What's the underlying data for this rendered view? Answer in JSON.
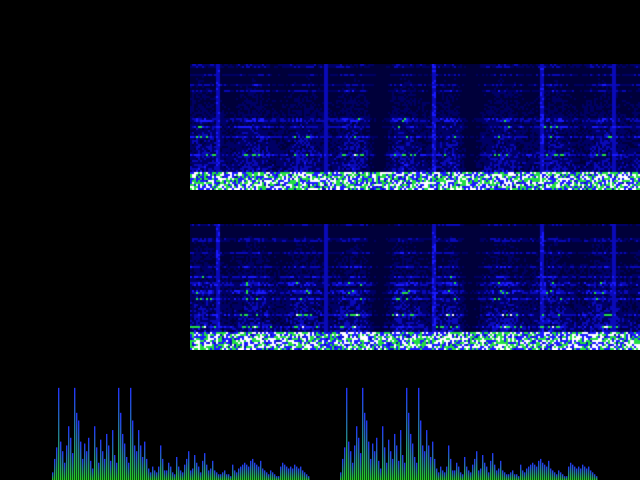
{
  "visualizer": {
    "background": "#000000",
    "palette": {
      "low": "#000066",
      "mid": "#1a1aff",
      "high": "#22dd44",
      "peak": "#ffffff"
    },
    "spectrogram": {
      "channels": [
        "left",
        "right"
      ],
      "columns": 225,
      "rows": 63,
      "transients": [
        {
          "t": 0.06,
          "level": 0.95
        },
        {
          "t": 0.3,
          "level": 0.9
        },
        {
          "t": 0.54,
          "level": 1.0
        },
        {
          "t": 0.78,
          "level": 0.95
        },
        {
          "t": 0.94,
          "level": 0.85
        }
      ],
      "pulse_count": 9
    },
    "spectrum": {
      "gradient_bottom": "#22cc22",
      "gradient_top": "#2233ff",
      "groups": [
        {
          "values": [
            0.08,
            0.22,
            0.34,
            0.96,
            0.4,
            0.3,
            0.18,
            0.36,
            0.56,
            0.44,
            0.28,
            0.96,
            0.7,
            0.62,
            0.4,
            0.22,
            0.38,
            0.3,
            0.44,
            0.2,
            0.12,
            0.56,
            0.34,
            0.18,
            0.42,
            0.3,
            0.22,
            0.48,
            0.36,
            0.2,
            0.52,
            0.26,
            0.18,
            0.96,
            0.7,
            0.48,
            0.38,
            0.24,
            0.18,
            0.96,
            0.62,
            0.36,
            0.3,
            0.52,
            0.36,
            0.24,
            0.4,
            0.22,
            0.12,
            0.08,
            0.14,
            0.1,
            0.08,
            0.14,
            0.36,
            0.22,
            0.1,
            0.1,
            0.18,
            0.14,
            0.08,
            0.06,
            0.24,
            0.14,
            0.1,
            0.08,
            0.16,
            0.22,
            0.3,
            0.1,
            0.12,
            0.26,
            0.18,
            0.14,
            0.08,
            0.2,
            0.28,
            0.16,
            0.1,
            0.12,
            0.2,
            0.1,
            0.08,
            0.06,
            0.06,
            0.08,
            0.1,
            0.06,
            0.06,
            0.04,
            0.16,
            0.1,
            0.08,
            0.12,
            0.14,
            0.16,
            0.18,
            0.16,
            0.14,
            0.2,
            0.22,
            0.18,
            0.16,
            0.14,
            0.2,
            0.12,
            0.1,
            0.08,
            0.06,
            0.1,
            0.08,
            0.06,
            0.04,
            0.04,
            0.14,
            0.18,
            0.16,
            0.14,
            0.12,
            0.14,
            0.12,
            0.16,
            0.14,
            0.12,
            0.14,
            0.1,
            0.08,
            0.06,
            0.04
          ]
        },
        {
          "values": [
            0.08,
            0.22,
            0.34,
            0.96,
            0.4,
            0.3,
            0.18,
            0.36,
            0.56,
            0.44,
            0.28,
            0.96,
            0.7,
            0.62,
            0.4,
            0.22,
            0.38,
            0.3,
            0.44,
            0.2,
            0.12,
            0.56,
            0.34,
            0.18,
            0.42,
            0.3,
            0.22,
            0.48,
            0.36,
            0.2,
            0.52,
            0.26,
            0.18,
            0.96,
            0.7,
            0.48,
            0.38,
            0.24,
            0.18,
            0.96,
            0.62,
            0.36,
            0.3,
            0.52,
            0.36,
            0.24,
            0.4,
            0.22,
            0.12,
            0.08,
            0.14,
            0.1,
            0.08,
            0.14,
            0.36,
            0.22,
            0.1,
            0.1,
            0.18,
            0.14,
            0.08,
            0.06,
            0.24,
            0.14,
            0.1,
            0.08,
            0.16,
            0.22,
            0.3,
            0.1,
            0.12,
            0.26,
            0.18,
            0.14,
            0.08,
            0.2,
            0.28,
            0.16,
            0.1,
            0.12,
            0.2,
            0.1,
            0.08,
            0.06,
            0.06,
            0.08,
            0.1,
            0.06,
            0.06,
            0.04,
            0.16,
            0.1,
            0.08,
            0.12,
            0.14,
            0.16,
            0.18,
            0.16,
            0.14,
            0.2,
            0.22,
            0.18,
            0.16,
            0.14,
            0.2,
            0.12,
            0.1,
            0.08,
            0.06,
            0.1,
            0.08,
            0.06,
            0.04,
            0.04,
            0.14,
            0.18,
            0.16,
            0.14,
            0.12,
            0.14,
            0.12,
            0.16,
            0.14,
            0.12,
            0.14,
            0.1,
            0.08,
            0.06,
            0.04
          ]
        }
      ]
    }
  }
}
